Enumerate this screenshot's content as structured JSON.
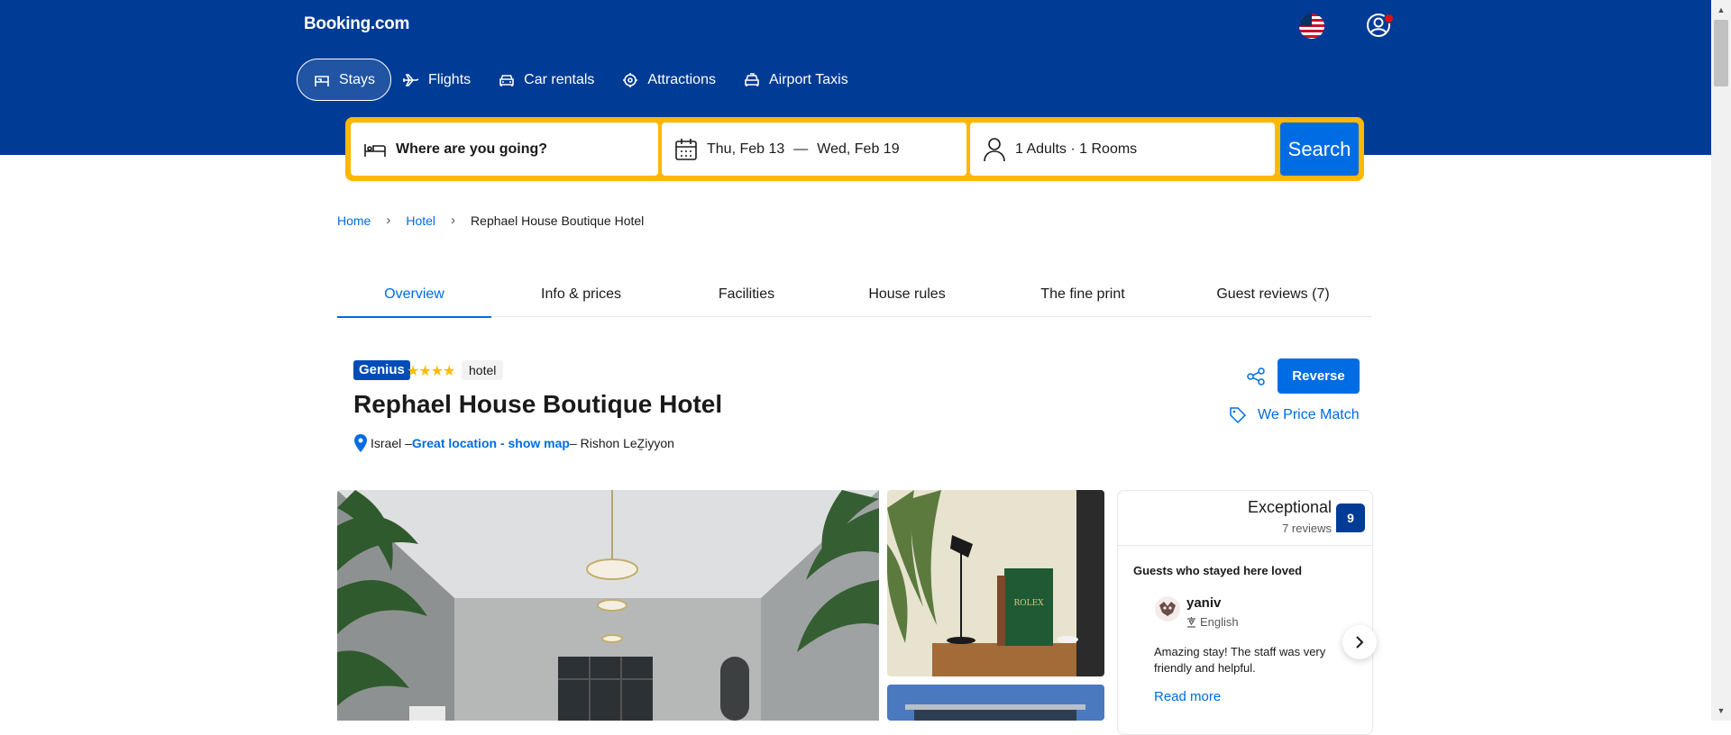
{
  "header": {
    "logo": "Booking.com",
    "nav": [
      {
        "label": "Stays",
        "icon": "bed-icon",
        "active": true
      },
      {
        "label": "Flights",
        "icon": "plane-icon"
      },
      {
        "label": "Car rentals",
        "icon": "car-icon"
      },
      {
        "label": "Attractions",
        "icon": "attractions-icon"
      },
      {
        "label": "Airport Taxis",
        "icon": "taxi-icon"
      }
    ]
  },
  "search": {
    "destination_placeholder": "Where are you going?",
    "check_in": "Thu, Feb 13",
    "date_separator": "—",
    "check_out": "Wed, Feb 19",
    "guests": "1 Adults · 1 Rooms",
    "button_label": "Search"
  },
  "breadcrumb": {
    "items": [
      "Home",
      "Hotel"
    ],
    "current": "Rephael House Boutique Hotel"
  },
  "tabs": [
    "Overview",
    "Info & prices",
    "Facilities",
    "House rules",
    "The fine print",
    "Guest reviews (7)"
  ],
  "hotel": {
    "genius_badge": "Genius",
    "stars": "★★★★",
    "property_type": "hotel",
    "name": "Rephael House Boutique Hotel",
    "country": "Israel –",
    "location_link": "Great location - show map",
    "city": "– Rishon LeẔiyyon",
    "reserve_label": "Reverse",
    "price_match_label": "We Price Match"
  },
  "reviews": {
    "score_word": "Exceptional",
    "count": "7 reviews",
    "score": "9",
    "loved_title": "Guests who stayed here loved",
    "reviewer": "yaniv",
    "language": "English",
    "text": "Amazing stay! The staff was very friendly and helpful.",
    "read_more": "Read more"
  },
  "colors": {
    "brand": "#003b95",
    "accent": "#006ce4",
    "search_border": "#ffb700"
  }
}
